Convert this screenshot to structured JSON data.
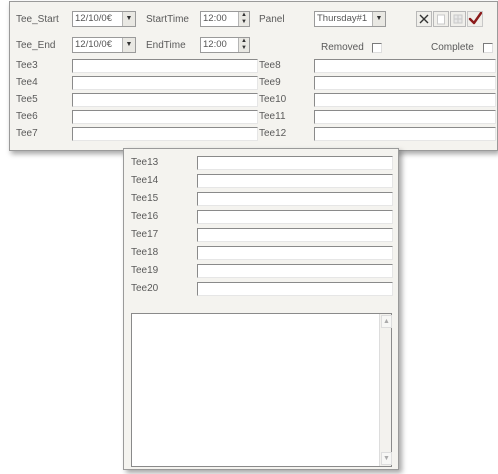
{
  "top_form": {
    "tee_start_label": "Tee_Start",
    "tee_start_date": "12/10/0€",
    "start_time_label": "StartTime",
    "start_time_value": "12:00",
    "panel_label": "Panel",
    "panel_value": "Thursday#1",
    "tee_end_label": "Tee_End",
    "tee_end_date": "12/10/0€",
    "end_time_label": "EndTime",
    "end_time_value": "12:00",
    "removed_label": "Removed",
    "complete_label": "Complete",
    "left_tees": [
      "Tee3",
      "Tee4",
      "Tee5",
      "Tee6",
      "Tee7"
    ],
    "right_tees": [
      "Tee8",
      "Tee9",
      "Tee10",
      "Tee11",
      "Tee12"
    ]
  },
  "bottom_form": {
    "tees": [
      "Tee13",
      "Tee14",
      "Tee15",
      "Tee16",
      "Tee17",
      "Tee18",
      "Tee19",
      "Tee20"
    ],
    "memo_value": ""
  },
  "toolbar": {
    "buttons": [
      "close-icon",
      "page-icon",
      "grid-icon",
      "checkmark-icon"
    ],
    "accent_close": "#333333",
    "accent_check": "#8b1a1a"
  }
}
